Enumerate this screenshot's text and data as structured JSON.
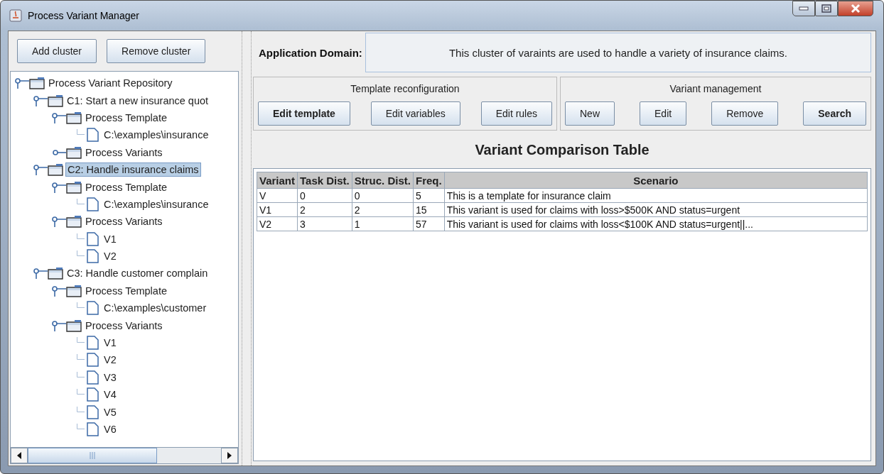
{
  "window": {
    "title": "Process Variant Manager"
  },
  "cluster_buttons": [
    "Add cluster",
    "Remove cluster"
  ],
  "tree": [
    {
      "label": "Process Variant Repository",
      "kind": "folder",
      "expanded": true,
      "selected": false,
      "children": [
        {
          "label": "C1: Start a new insurance quot",
          "kind": "folder",
          "expanded": true,
          "selected": false,
          "children": [
            {
              "label": "Process Template",
              "kind": "folder",
              "expanded": true,
              "selected": false,
              "children": [
                {
                  "label": "C:\\examples\\insurance",
                  "kind": "file",
                  "selected": false
                }
              ]
            },
            {
              "label": "Process Variants",
              "kind": "folder",
              "expanded": false,
              "selected": false
            }
          ]
        },
        {
          "label": "C2: Handle insurance claims",
          "kind": "folder",
          "expanded": true,
          "selected": true,
          "children": [
            {
              "label": "Process Template",
              "kind": "folder",
              "expanded": true,
              "selected": false,
              "children": [
                {
                  "label": "C:\\examples\\insurance",
                  "kind": "file",
                  "selected": false
                }
              ]
            },
            {
              "label": "Process Variants",
              "kind": "folder",
              "expanded": true,
              "selected": false,
              "children": [
                {
                  "label": "V1",
                  "kind": "file",
                  "selected": false
                },
                {
                  "label": "V2",
                  "kind": "file",
                  "selected": false
                }
              ]
            }
          ]
        },
        {
          "label": "C3: Handle customer complain",
          "kind": "folder",
          "expanded": true,
          "selected": false,
          "children": [
            {
              "label": "Process Template",
              "kind": "folder",
              "expanded": true,
              "selected": false,
              "children": [
                {
                  "label": "C:\\examples\\customer",
                  "kind": "file",
                  "selected": false
                }
              ]
            },
            {
              "label": "Process Variants",
              "kind": "folder",
              "expanded": true,
              "selected": false,
              "children": [
                {
                  "label": "V1",
                  "kind": "file",
                  "selected": false
                },
                {
                  "label": "V2",
                  "kind": "file",
                  "selected": false
                },
                {
                  "label": "V3",
                  "kind": "file",
                  "selected": false
                },
                {
                  "label": "V4",
                  "kind": "file",
                  "selected": false
                },
                {
                  "label": "V5",
                  "kind": "file",
                  "selected": false
                },
                {
                  "label": "V6",
                  "kind": "file",
                  "selected": false
                }
              ]
            }
          ]
        }
      ]
    }
  ],
  "application_domain": {
    "label": "Application Domain:",
    "value": "This cluster of varaints are used to handle a variety of insurance claims."
  },
  "groups": [
    {
      "title": "Template reconfiguration",
      "buttons": [
        {
          "label": "Edit template",
          "default": true
        },
        {
          "label": "Edit variables",
          "default": false
        },
        {
          "label": "Edit rules",
          "default": false
        }
      ]
    },
    {
      "title": "Variant management",
      "buttons": [
        {
          "label": "New",
          "default": false
        },
        {
          "label": "Edit",
          "default": false
        },
        {
          "label": "Remove",
          "default": false
        },
        {
          "label": "Search",
          "default": true
        }
      ]
    }
  ],
  "table": {
    "title": "Variant Comparison Table",
    "columns": [
      "Variant",
      "Task Dist.",
      "Struc. Dist.",
      "Freq.",
      "Scenario"
    ],
    "rows": [
      [
        "V",
        "0",
        "0",
        "5",
        "This is a template for insurance claim"
      ],
      [
        "V1",
        "2",
        "2",
        "15",
        "This variant is used for claims with loss>$500K AND status=urgent"
      ],
      [
        "V2",
        "3",
        "1",
        "57",
        "This variant is used for claims with loss<$100K AND status=urgent||..."
      ]
    ]
  }
}
